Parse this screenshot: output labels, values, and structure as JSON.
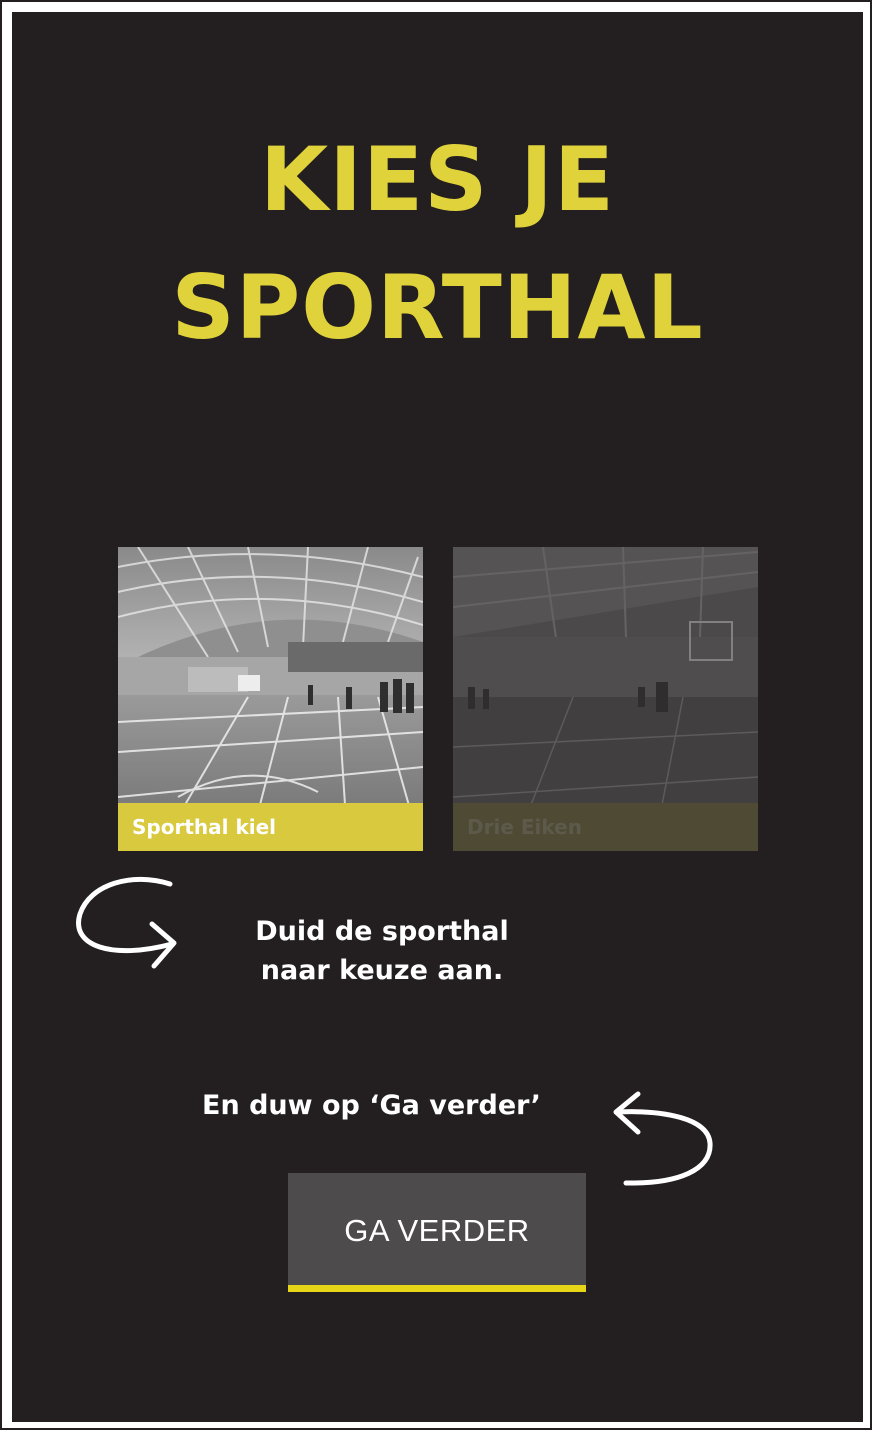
{
  "title": {
    "line1": "KIES JE",
    "line2": "SPORTHAL"
  },
  "halls": [
    {
      "name": "Sporthal kiel",
      "selected": true,
      "image_icon": "sports-hall-photo-icon"
    },
    {
      "name": "Drie Eiken",
      "selected": false,
      "image_icon": "sports-hall-photo-icon"
    }
  ],
  "hints": {
    "select_line1": "Duid de sporthal",
    "select_line2": "naar keuze aan.",
    "continue": "En duw op ‘Ga verder’"
  },
  "button": {
    "label": "GA VERDER"
  },
  "colors": {
    "background": "#231f20",
    "accent_yellow": "#e0d23a",
    "button_bg": "#4d4b4c",
    "button_underline": "#e6d617"
  }
}
